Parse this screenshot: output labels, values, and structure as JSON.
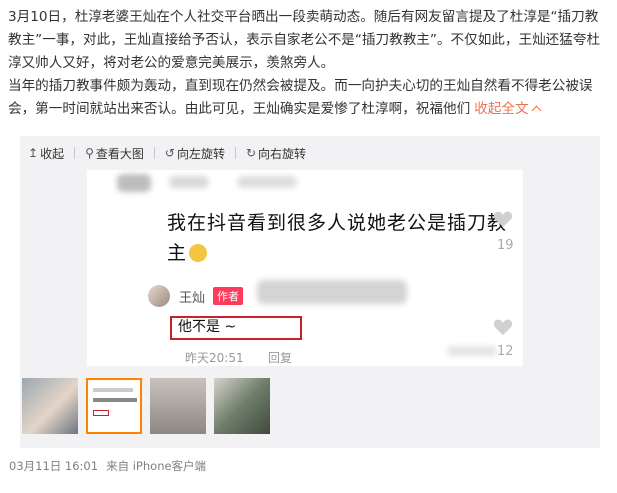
{
  "post": {
    "paragraph1": "3月10日，杜淳老婆王灿在个人社交平台晒出一段卖萌动态。随后有网友留言提及了杜淳是“插刀教教主”一事，对此，王灿直接给予否认，表示自家老公不是“插刀教教主”。不仅如此，王灿还猛夸杜淳又帅人又好，将对老公的爱意完美展示，羡煞旁人。",
    "paragraph2": "当年的插刀教事件颇为轰动，直到现在仍然会被提及。而一向护夫心切的王灿自然看不得老公被误会，第一时间就站出来否认。由此可见，王灿确实是爱惨了杜淳啊，祝福他们",
    "collapse_label": "收起全文"
  },
  "toolbar": {
    "collapse": "收起",
    "view_large": "查看大图",
    "rotate_left": "向左旋转",
    "rotate_right": "向右旋转"
  },
  "image": {
    "comment_line1": "我在抖音看到很多人说她老公是插刀教",
    "comment_line2": "主",
    "like_count_1": "19",
    "reply_name": "王灿",
    "author_tag": "作者",
    "reply_text": "他不是 ~",
    "reply_time": "昨天20:51",
    "reply_link": "回复",
    "like_count_2": "12"
  },
  "thumbnails": [
    {
      "label": "thumb-1"
    },
    {
      "label": "thumb-2"
    },
    {
      "label": "thumb-3"
    },
    {
      "label": "thumb-4"
    }
  ],
  "meta": {
    "date": "03月11日 16:01",
    "source": "来自 iPhone客户端"
  },
  "colors": {
    "accent": "#eb7350",
    "highlight_border": "#c8202d",
    "author_tag": "#ff3b5c",
    "selected_thumb": "#ff8200"
  }
}
